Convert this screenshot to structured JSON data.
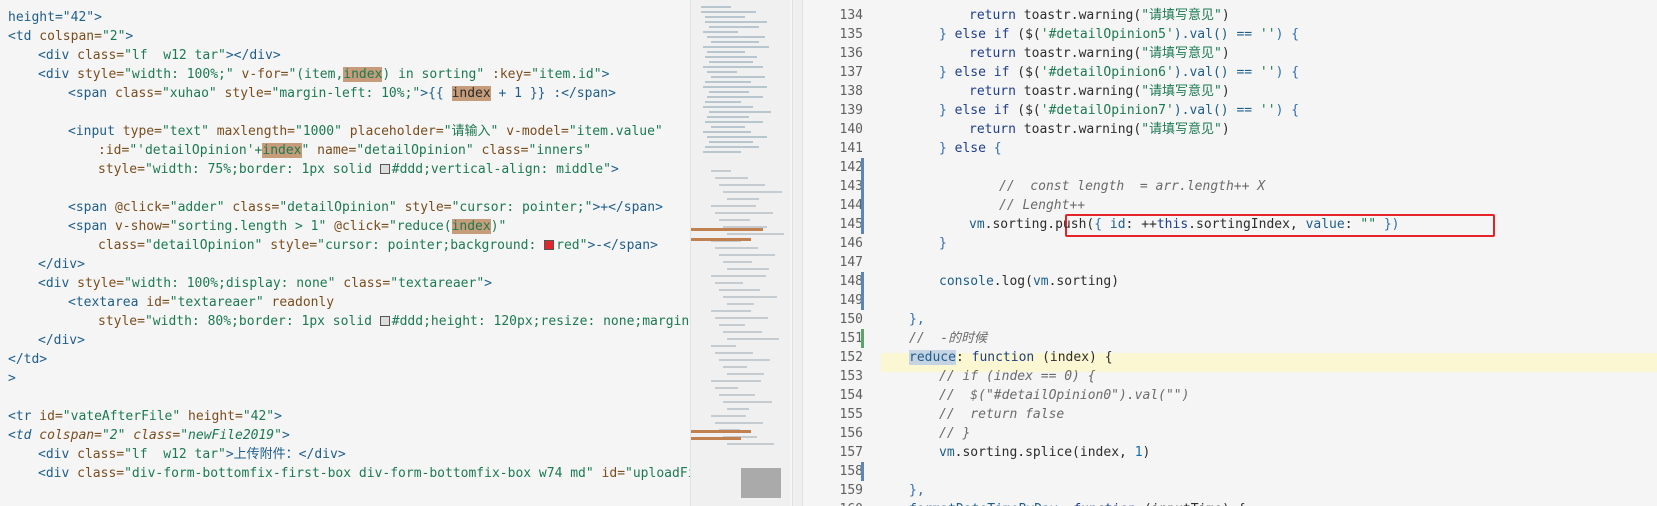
{
  "left_editor": {
    "lines": [
      {
        "indent": 0,
        "html_key": "l0"
      },
      {
        "indent": 0,
        "html_key": "l1"
      },
      {
        "indent": 1,
        "html_key": "l2"
      },
      {
        "indent": 1,
        "html_key": "l3"
      },
      {
        "indent": 2,
        "html_key": "l4"
      },
      {
        "indent": 0,
        "html_key": "blank"
      },
      {
        "indent": 2,
        "html_key": "l6"
      },
      {
        "indent": 3,
        "html_key": "l7"
      },
      {
        "indent": 3,
        "html_key": "l8"
      },
      {
        "indent": 0,
        "html_key": "blank"
      },
      {
        "indent": 2,
        "html_key": "l10"
      },
      {
        "indent": 2,
        "html_key": "l11"
      },
      {
        "indent": 3,
        "html_key": "l12"
      },
      {
        "indent": 1,
        "html_key": "l13"
      },
      {
        "indent": 1,
        "html_key": "l14"
      },
      {
        "indent": 2,
        "html_key": "l15"
      },
      {
        "indent": 3,
        "html_key": "l16"
      },
      {
        "indent": 1,
        "html_key": "l17"
      },
      {
        "indent": 0,
        "html_key": "l18"
      },
      {
        "indent": 0,
        "html_key": "l19"
      },
      {
        "indent": 0,
        "html_key": "blank"
      },
      {
        "indent": 0,
        "html_key": "l21"
      },
      {
        "indent": 0,
        "html_key": "l22"
      },
      {
        "indent": 1,
        "html_key": "l23"
      },
      {
        "indent": 1,
        "html_key": "l24"
      }
    ],
    "text": {
      "l0": "height=\"42\">",
      "l1a": "<td",
      "l1b": " colspan=",
      "l1c": "\"2\"",
      "l1d": ">",
      "l2a": "<div",
      "l2b": " class=",
      "l2c": "\"lf  w12 tar\"",
      "l2d": "></div>",
      "l3a": "<div",
      "l3b": " style=",
      "l3c": "\"width: 100%;\"",
      "l3d": " v-for=",
      "l3e": "\"(item,",
      "l3f": "index",
      "l3g": ") in sorting\"",
      "l3h": " :key=",
      "l3i": "\"item.id\"",
      "l3j": ">",
      "l4a": "<span",
      "l4b": " class=",
      "l4c": "\"xuhao\"",
      "l4d": " style=",
      "l4e": "\"margin-left: 10%;\"",
      "l4f": ">{{ ",
      "l4g": "index",
      "l4h": " + 1 }} :</span>",
      "l6a": "<input",
      "l6b": " type=",
      "l6c": "\"text\"",
      "l6d": " maxlength=",
      "l6e": "\"1000\"",
      "l6f": " placeholder=",
      "l6g": "\"请输入\"",
      "l6h": " v-model=",
      "l6i": "\"item.value\"",
      "l7a": ":id=",
      "l7b": "\"'detailOpinion'+",
      "l7c": "index",
      "l7d": "\"",
      "l7e": " name=",
      "l7f": "\"detailOpinion\"",
      "l7g": " class=",
      "l7h": "\"inners\"",
      "l8a": "style=",
      "l8b": "\"width: 75%;border: 1px solid ",
      "l8c": "#ddd;vertical-align: middle\"",
      "l8d": ">",
      "l10a": "<span",
      "l10b": " @click=",
      "l10c": "\"adder\"",
      "l10d": " class=",
      "l10e": "\"detailOpinion\"",
      "l10f": " style=",
      "l10g": "\"cursor: pointer;\"",
      "l10h": ">+</span>",
      "l11a": "<span",
      "l11b": " v-show=",
      "l11c": "\"sorting.length > 1\"",
      "l11d": " @click=",
      "l11e": "\"reduce(",
      "l11f": "index",
      "l11g": ")\"",
      "l12a": "class=",
      "l12b": "\"detailOpinion\"",
      "l12c": " style=",
      "l12d": "\"cursor: pointer;background: ",
      "l12e": "red\"",
      "l12f": ">-</span>",
      "l13": "</div>",
      "l14a": "<div",
      "l14b": " style=",
      "l14c": "\"width: 100%;display: none\"",
      "l14d": " class=",
      "l14e": "\"textareaer\"",
      "l14f": ">",
      "l15a": "<textarea",
      "l15b": " id=",
      "l15c": "\"textareaer\"",
      "l15d": " readonly",
      "l16a": "style=",
      "l16b": "\"width: 80%;border: 1px solid ",
      "l16c": "#ddd;height: 120px;resize: none;margin",
      "l17": "</div>",
      "l18": "</td>",
      "l19": ">",
      "l21a": "<tr",
      "l21b": " id=",
      "l21c": "\"vateAfterFile\"",
      "l21d": " height=",
      "l21e": "\"42\"",
      "l21f": ">",
      "l22a": "<td",
      "l22b": " colspan=",
      "l22c": "\"2\"",
      "l22d": " class=",
      "l22e": "\"newFile2019\"",
      "l22f": ">",
      "l23a": "<div",
      "l23b": " class=",
      "l23c": "\"lf  w12 tar\"",
      "l23d": ">上传附件：</div>",
      "l24a": "<div",
      "l24b": " class=",
      "l24c": "\"div-form-bottomfix-first-box div-form-bottomfix-box w74 md\"",
      "l24d": " id=",
      "l24e": "\"uploadFil"
    }
  },
  "right_editor": {
    "line_numbers": [
      "134",
      "135",
      "136",
      "137",
      "138",
      "139",
      "140",
      "141",
      "142",
      "143",
      "144",
      "145",
      "146",
      "147",
      "148",
      "149",
      "150",
      "151",
      "152",
      "153",
      "154",
      "155",
      "156",
      "157",
      "158",
      "159",
      "160"
    ],
    "text": {
      "r134a": "return ",
      "r134b": "toastr",
      "r134c": ".warning(",
      "r134d": "\"请填写意见\"",
      "r134e": ")",
      "r135a": "} ",
      "r135b": "else if ",
      "r135c": "(",
      "r135d": "$(",
      "r135e": "'#detailOpinion5'",
      "r135f": ").val() == ",
      "r135g": "''",
      "r135h": ") {",
      "r136a": "return ",
      "r136b": "toastr",
      "r136c": ".warning(",
      "r136d": "\"请填写意见\"",
      "r136e": ")",
      "r137a": "} ",
      "r137b": "else if ",
      "r137c": "(",
      "r137d": "$(",
      "r137e": "'#detailOpinion6'",
      "r137f": ").val() == ",
      "r137g": "''",
      "r137h": ") {",
      "r138a": "return ",
      "r138b": "toastr",
      "r138c": ".warning(",
      "r138d": "\"请填写意见\"",
      "r138e": ")",
      "r139a": "} ",
      "r139b": "else if ",
      "r139c": "(",
      "r139d": "$(",
      "r139e": "'#detailOpinion7'",
      "r139f": ").val() == ",
      "r139g": "''",
      "r139h": ") {",
      "r140a": "return ",
      "r140b": "toastr",
      "r140c": ".warning(",
      "r140d": "\"请填写意见\"",
      "r140e": ")",
      "r141a": "} ",
      "r141b": "else ",
      "r141c": "{",
      "r143": "//  const length  = arr.length++ X",
      "r144": "// Lenght++",
      "r145a": "vm",
      "r145b": ".sorting.push(",
      "r145c": "{ ",
      "r145d": "id",
      "r145e": ": ++",
      "r145f": "this",
      "r145g": ".sortingIndex, ",
      "r145h": "value",
      "r145i": ": ",
      "r145j": "\"\"",
      "r145k": " })",
      "r146": "}",
      "r148a": "console",
      "r148b": ".log(",
      "r148c": "vm",
      "r148d": ".sorting)",
      "r150": "},",
      "r151": "//  -的时候",
      "r152a": "reduce",
      "r152b": ": ",
      "r152c": "function ",
      "r152d": "(index) {",
      "r153": "// if (index == 0) {",
      "r154": "//  $(\"#detailOpinion0\").val(\"\")",
      "r155": "//  return false",
      "r156": "// }",
      "r157a": "vm",
      "r157b": ".sorting.splice(",
      "r157c": "index",
      "r157d": ", ",
      "r157e": "1",
      "r157f": ")",
      "r159": "},",
      "r160a": "formatDateTimeByDay",
      "r160b": ": ",
      "r160c": "function ",
      "r160d": "(inputTime) {"
    }
  },
  "colors": {
    "accent_red_box": "#e3252b",
    "highlight_index": "#c79c7a",
    "current_line": "#fbf7d2",
    "gutter_modified": "#5a87b8",
    "gutter_added": "#5aa56b"
  }
}
